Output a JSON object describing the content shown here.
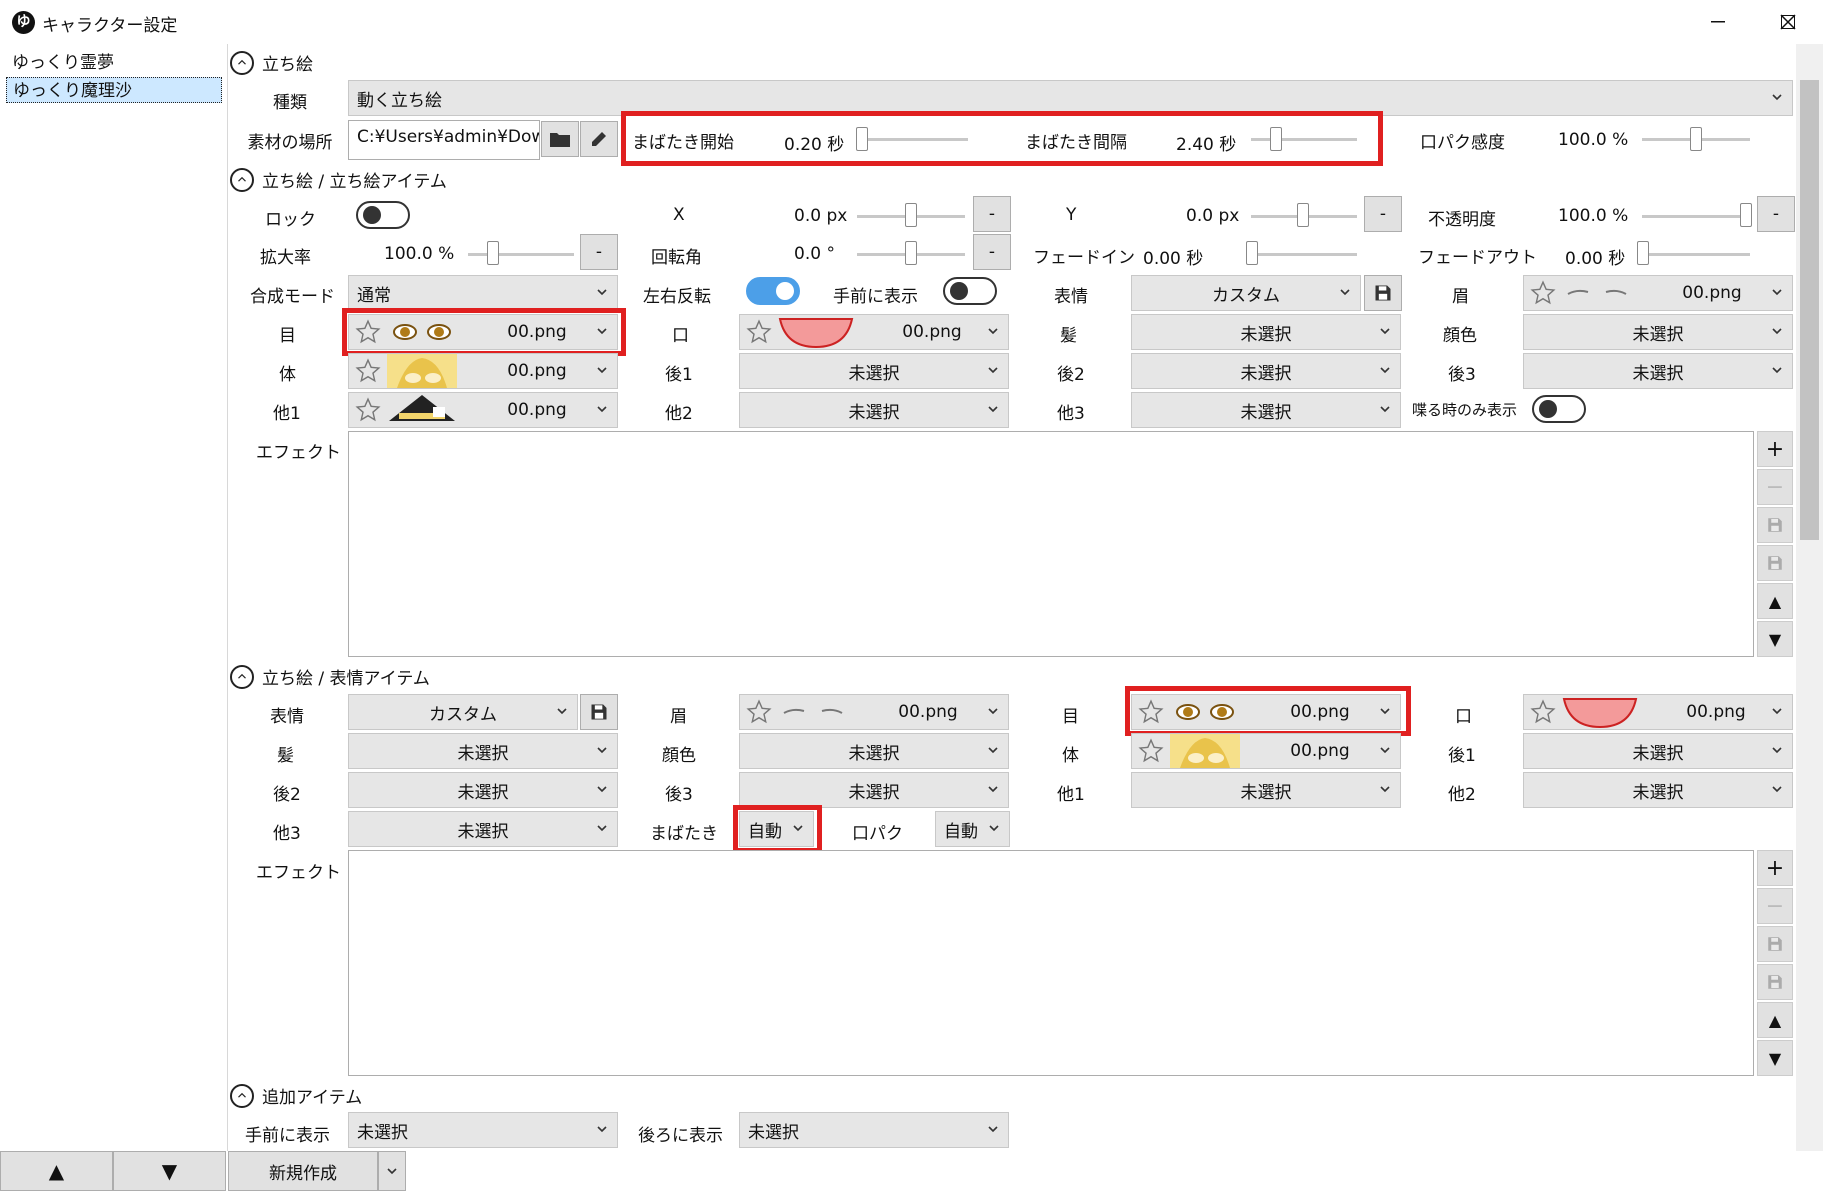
{
  "window": {
    "title": "キャラクター設定",
    "app_icon": "ゆ"
  },
  "characters": [
    "ゆっくり霊夢",
    "ゆっくり魔理沙"
  ],
  "left_buttons": {
    "up": "▲",
    "down": "▼"
  },
  "new_button": {
    "label": "新規作成"
  },
  "sec1": {
    "title": "立ち絵",
    "kind_label": "種類",
    "kind_value": "動く立ち絵",
    "path_label": "素材の場所",
    "path_value": "C:¥Users¥admin¥Dowr",
    "blink_start_label": "まばたき開始",
    "blink_start_value": "0.20 秒",
    "blink_interval_label": "まばたき間隔",
    "blink_interval_value": "2.40 秒",
    "lip_label": "口パク感度",
    "lip_value": "100.0 %"
  },
  "sec2": {
    "title": "立ち絵 / 立ち絵アイテム",
    "lock": "ロック",
    "x": "X",
    "x_value": "0.0 px",
    "y": "Y",
    "y_value": "0.0 px",
    "opacity": "不透明度",
    "opacity_value": "100.0 %",
    "zoom": "拡大率",
    "zoom_value": "100.0 %",
    "rotate": "回転角",
    "rotate_value": "0.0 °",
    "fadein": "フェードイン",
    "fadein_value": "0.00 秒",
    "fadeout": "フェードアウト",
    "fadeout_value": "0.00 秒",
    "blend": "合成モード",
    "blend_value": "通常",
    "flip": "左右反転",
    "front": "手前に表示",
    "expr": "表情",
    "expr_value": "カスタム",
    "brow": "眉",
    "brow_value": "00.png",
    "eye": "目",
    "eye_value": "00.png",
    "mouth": "口",
    "mouth_value": "00.png",
    "hair": "髪",
    "hair_value": "未選択",
    "face": "顔色",
    "face_value": "未選択",
    "body": "体",
    "body_value": "00.png",
    "back1": "後1",
    "back1_value": "未選択",
    "back2": "後2",
    "back2_value": "未選択",
    "back3": "後3",
    "back3_value": "未選択",
    "other1": "他1",
    "other1_value": "00.png",
    "other2": "他2",
    "other2_value": "未選択",
    "other3": "他3",
    "other3_value": "未選択",
    "speak_only": "喋る時のみ表示",
    "effect": "エフェクト",
    "minus": "-"
  },
  "sec3": {
    "title": "立ち絵 / 表情アイテム",
    "expr": "表情",
    "expr_value": "カスタム",
    "brow": "眉",
    "brow_value": "00.png",
    "eye": "目",
    "eye_value": "00.png",
    "mouth": "口",
    "mouth_value": "00.png",
    "hair": "髪",
    "hair_value": "未選択",
    "face": "顔色",
    "face_value": "未選択",
    "body": "体",
    "body_value": "00.png",
    "back1": "後1",
    "back1_value": "未選択",
    "back2": "後2",
    "back2_value": "未選択",
    "back3": "後3",
    "back3_value": "未選択",
    "other1": "他1",
    "other1_value": "未選択",
    "other2": "他2",
    "other2_value": "未選択",
    "other3": "他3",
    "other3_value": "未選択",
    "blink": "まばたき",
    "blink_value": "自動",
    "lip": "口パク",
    "lip_value": "自動",
    "effect": "エフェクト"
  },
  "sec4": {
    "title": "追加アイテム",
    "front": "手前に表示",
    "front_value": "未選択",
    "back": "後ろに表示",
    "back_value": "未選択"
  },
  "side_buttons": {
    "add": "+",
    "remove": "−",
    "up": "▲",
    "down": "▼"
  },
  "colors": {
    "highlight": "#e02020",
    "toggle_on": "#4c9fe8",
    "selection": "#cde8ff"
  }
}
